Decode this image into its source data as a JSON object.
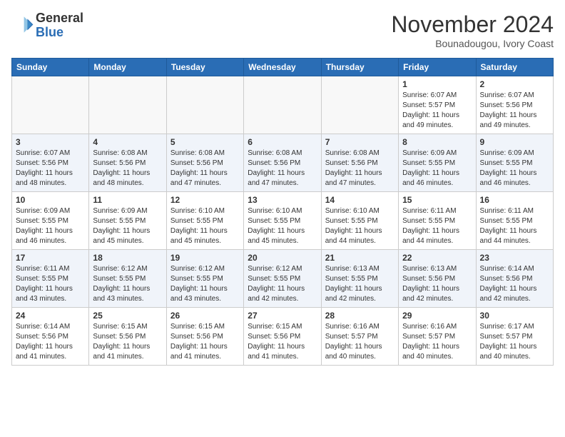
{
  "header": {
    "logo_general": "General",
    "logo_blue": "Blue",
    "month_title": "November 2024",
    "location": "Bounadougou, Ivory Coast"
  },
  "calendar": {
    "days_of_week": [
      "Sunday",
      "Monday",
      "Tuesday",
      "Wednesday",
      "Thursday",
      "Friday",
      "Saturday"
    ],
    "weeks": [
      [
        {
          "day": "",
          "info": ""
        },
        {
          "day": "",
          "info": ""
        },
        {
          "day": "",
          "info": ""
        },
        {
          "day": "",
          "info": ""
        },
        {
          "day": "",
          "info": ""
        },
        {
          "day": "1",
          "info": "Sunrise: 6:07 AM\nSunset: 5:57 PM\nDaylight: 11 hours and 49 minutes."
        },
        {
          "day": "2",
          "info": "Sunrise: 6:07 AM\nSunset: 5:56 PM\nDaylight: 11 hours and 49 minutes."
        }
      ],
      [
        {
          "day": "3",
          "info": "Sunrise: 6:07 AM\nSunset: 5:56 PM\nDaylight: 11 hours and 48 minutes."
        },
        {
          "day": "4",
          "info": "Sunrise: 6:08 AM\nSunset: 5:56 PM\nDaylight: 11 hours and 48 minutes."
        },
        {
          "day": "5",
          "info": "Sunrise: 6:08 AM\nSunset: 5:56 PM\nDaylight: 11 hours and 47 minutes."
        },
        {
          "day": "6",
          "info": "Sunrise: 6:08 AM\nSunset: 5:56 PM\nDaylight: 11 hours and 47 minutes."
        },
        {
          "day": "7",
          "info": "Sunrise: 6:08 AM\nSunset: 5:56 PM\nDaylight: 11 hours and 47 minutes."
        },
        {
          "day": "8",
          "info": "Sunrise: 6:09 AM\nSunset: 5:55 PM\nDaylight: 11 hours and 46 minutes."
        },
        {
          "day": "9",
          "info": "Sunrise: 6:09 AM\nSunset: 5:55 PM\nDaylight: 11 hours and 46 minutes."
        }
      ],
      [
        {
          "day": "10",
          "info": "Sunrise: 6:09 AM\nSunset: 5:55 PM\nDaylight: 11 hours and 46 minutes."
        },
        {
          "day": "11",
          "info": "Sunrise: 6:09 AM\nSunset: 5:55 PM\nDaylight: 11 hours and 45 minutes."
        },
        {
          "day": "12",
          "info": "Sunrise: 6:10 AM\nSunset: 5:55 PM\nDaylight: 11 hours and 45 minutes."
        },
        {
          "day": "13",
          "info": "Sunrise: 6:10 AM\nSunset: 5:55 PM\nDaylight: 11 hours and 45 minutes."
        },
        {
          "day": "14",
          "info": "Sunrise: 6:10 AM\nSunset: 5:55 PM\nDaylight: 11 hours and 44 minutes."
        },
        {
          "day": "15",
          "info": "Sunrise: 6:11 AM\nSunset: 5:55 PM\nDaylight: 11 hours and 44 minutes."
        },
        {
          "day": "16",
          "info": "Sunrise: 6:11 AM\nSunset: 5:55 PM\nDaylight: 11 hours and 44 minutes."
        }
      ],
      [
        {
          "day": "17",
          "info": "Sunrise: 6:11 AM\nSunset: 5:55 PM\nDaylight: 11 hours and 43 minutes."
        },
        {
          "day": "18",
          "info": "Sunrise: 6:12 AM\nSunset: 5:55 PM\nDaylight: 11 hours and 43 minutes."
        },
        {
          "day": "19",
          "info": "Sunrise: 6:12 AM\nSunset: 5:55 PM\nDaylight: 11 hours and 43 minutes."
        },
        {
          "day": "20",
          "info": "Sunrise: 6:12 AM\nSunset: 5:55 PM\nDaylight: 11 hours and 42 minutes."
        },
        {
          "day": "21",
          "info": "Sunrise: 6:13 AM\nSunset: 5:55 PM\nDaylight: 11 hours and 42 minutes."
        },
        {
          "day": "22",
          "info": "Sunrise: 6:13 AM\nSunset: 5:56 PM\nDaylight: 11 hours and 42 minutes."
        },
        {
          "day": "23",
          "info": "Sunrise: 6:14 AM\nSunset: 5:56 PM\nDaylight: 11 hours and 42 minutes."
        }
      ],
      [
        {
          "day": "24",
          "info": "Sunrise: 6:14 AM\nSunset: 5:56 PM\nDaylight: 11 hours and 41 minutes."
        },
        {
          "day": "25",
          "info": "Sunrise: 6:15 AM\nSunset: 5:56 PM\nDaylight: 11 hours and 41 minutes."
        },
        {
          "day": "26",
          "info": "Sunrise: 6:15 AM\nSunset: 5:56 PM\nDaylight: 11 hours and 41 minutes."
        },
        {
          "day": "27",
          "info": "Sunrise: 6:15 AM\nSunset: 5:56 PM\nDaylight: 11 hours and 41 minutes."
        },
        {
          "day": "28",
          "info": "Sunrise: 6:16 AM\nSunset: 5:57 PM\nDaylight: 11 hours and 40 minutes."
        },
        {
          "day": "29",
          "info": "Sunrise: 6:16 AM\nSunset: 5:57 PM\nDaylight: 11 hours and 40 minutes."
        },
        {
          "day": "30",
          "info": "Sunrise: 6:17 AM\nSunset: 5:57 PM\nDaylight: 11 hours and 40 minutes."
        }
      ]
    ]
  }
}
